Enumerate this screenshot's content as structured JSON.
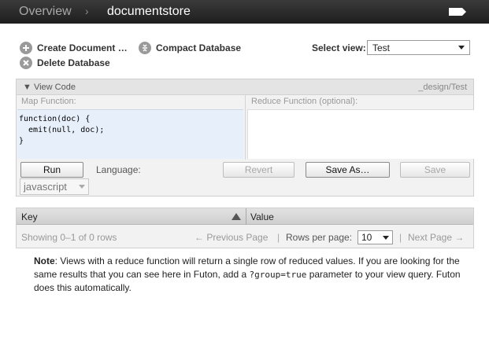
{
  "header": {
    "breadcrumb_overview": "Overview",
    "breadcrumb_separator": "›",
    "breadcrumb_database": "documentstore"
  },
  "toolbar": {
    "create_document_label": "Create Document …",
    "compact_database_label": "Compact Database",
    "delete_database_label": "Delete Database",
    "select_view_label": "Select view:",
    "select_view_value": "Test"
  },
  "view_code": {
    "toggle_label": "▼ View Code",
    "design_doc": "_design/Test",
    "map_label": "Map Function:",
    "reduce_label": "Reduce Function (optional):",
    "map_code": "function(doc) {\n  emit(null, doc);\n}",
    "reduce_code": "",
    "run_label": "Run",
    "language_label": "Language:",
    "language_value": "javascript",
    "revert_label": "Revert",
    "save_as_label": "Save As…",
    "save_label": "Save"
  },
  "results": {
    "key_header": "Key",
    "value_header": "Value",
    "showing_text": "Showing 0–1 of 0 rows",
    "previous_page": "← Previous Page",
    "pipe": "|",
    "rows_per_page_label": "Rows per page:",
    "rows_per_page_value": "10",
    "next_page": "Next Page →"
  },
  "note": {
    "bold": "Note",
    "text_part1": ": Views with a reduce function will return a single row of reduced values. If you are looking for the same results that you can see here in Futon, add a ",
    "code": "?group=true",
    "text_part2": " parameter to your view query. Futon does this automatically."
  },
  "colors": {
    "header_bg": "#2a2a2a",
    "map_area_bg": "#e7f0fa",
    "panel_bg": "#f2f2f2"
  },
  "icons": {
    "create": "plus-circle-icon",
    "compact": "compress-circle-icon",
    "delete": "x-circle-icon",
    "header_tag": "tag-icon"
  }
}
